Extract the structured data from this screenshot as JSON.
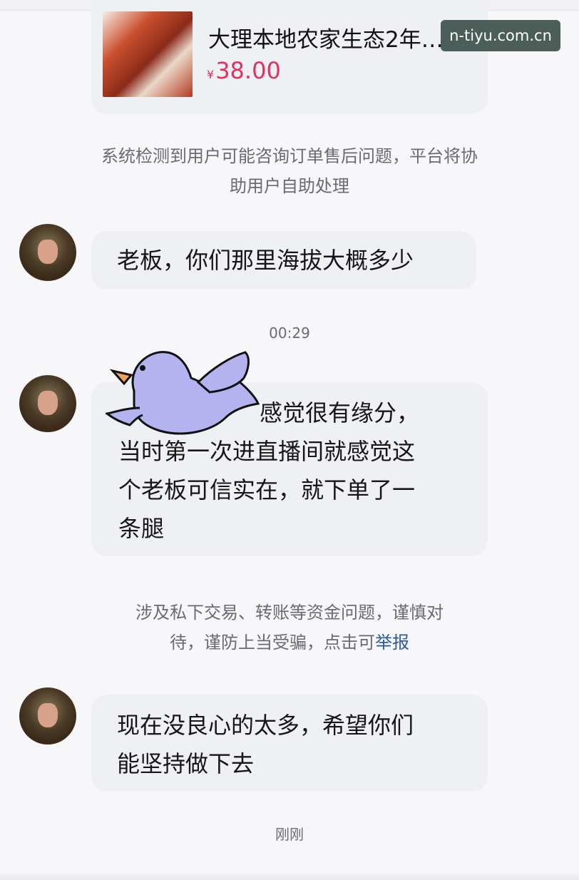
{
  "product": {
    "title": "大理本地农家生态2年…",
    "price_currency": "¥",
    "price": "38.00"
  },
  "watermark": "n-tiyu.com.cn",
  "system_notices": [
    {
      "line1": "系统检测到用户可能咨询订单售后问题，平台将协",
      "line2": "助用户自助处理"
    },
    {
      "line1": "涉及私下交易、转账等资金问题，谨慎对",
      "line2_prefix": "待，谨防上当受骗，点击可",
      "link": "举报"
    }
  ],
  "messages": [
    {
      "lines": [
        "老板，你们那里海拔大概多少"
      ]
    },
    {
      "lines": [
        "感觉很有缘分，",
        "当时第一次进直播间就感觉这",
        "个老板可信实在，就下单了一",
        "条腿"
      ]
    },
    {
      "lines": [
        "现在没良心的太多，希望你们",
        "能坚持做下去"
      ]
    }
  ],
  "timestamps": [
    "00:29",
    "刚刚"
  ],
  "colors": {
    "price": "#e0325f",
    "link": "#2f5a99",
    "bubble": "#eef0f4",
    "bird": "#b5b2f0"
  },
  "icons": {
    "sticker": "blue-bird-sticker"
  }
}
